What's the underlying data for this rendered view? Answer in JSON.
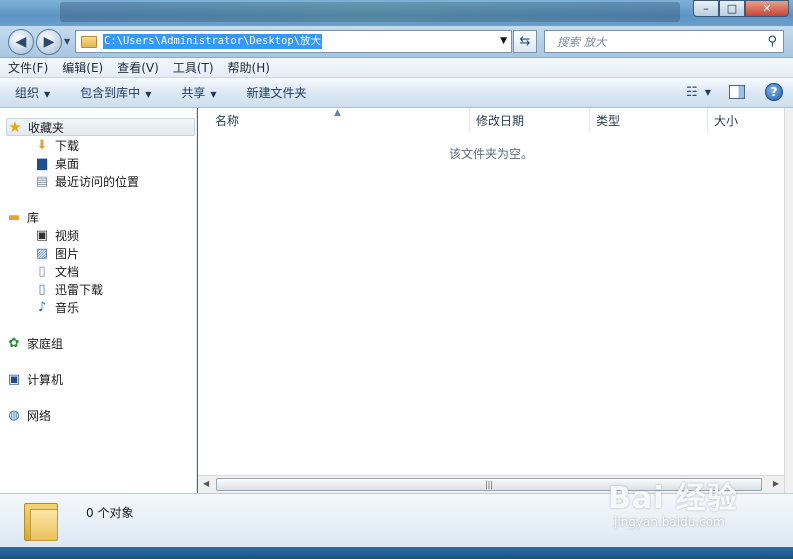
{
  "window": {
    "controls": {
      "minimize": "–",
      "maximize": "□",
      "close": "✕"
    }
  },
  "address": {
    "path": "C:\\Users\\Administrator\\Desktop\\放大"
  },
  "search": {
    "placeholder": "搜索 放大"
  },
  "menu": {
    "items": [
      {
        "label": "文件(F)"
      },
      {
        "label": "编辑(E)"
      },
      {
        "label": "查看(V)"
      },
      {
        "label": "工具(T)"
      },
      {
        "label": "帮助(H)"
      }
    ]
  },
  "toolbar": {
    "organize": "组织",
    "include_library": "包含到库中",
    "share": "共享",
    "new_folder": "新建文件夹"
  },
  "sidebar": {
    "favorites": {
      "label": "收藏夹",
      "items": [
        {
          "label": "下载",
          "icon": "download-folder-icon"
        },
        {
          "label": "桌面",
          "icon": "desktop-icon"
        },
        {
          "label": "最近访问的位置",
          "icon": "recent-places-icon"
        }
      ]
    },
    "libraries": {
      "label": "库",
      "items": [
        {
          "label": "视频",
          "icon": "video-icon"
        },
        {
          "label": "图片",
          "icon": "picture-icon"
        },
        {
          "label": "文档",
          "icon": "document-icon"
        },
        {
          "label": "迅雷下载",
          "icon": "xunlei-download-icon"
        },
        {
          "label": "音乐",
          "icon": "music-icon"
        }
      ]
    },
    "homegroup": {
      "label": "家庭组"
    },
    "computer": {
      "label": "计算机"
    },
    "network": {
      "label": "网络"
    }
  },
  "columns": [
    {
      "label": "名称"
    },
    {
      "label": "修改日期"
    },
    {
      "label": "类型"
    },
    {
      "label": "大小"
    }
  ],
  "content": {
    "empty_message": "该文件夹为空。"
  },
  "details": {
    "object_count": "0 个对象"
  },
  "watermark": {
    "logo": "Bai 经验",
    "url": "jingyan.baidu.com"
  }
}
